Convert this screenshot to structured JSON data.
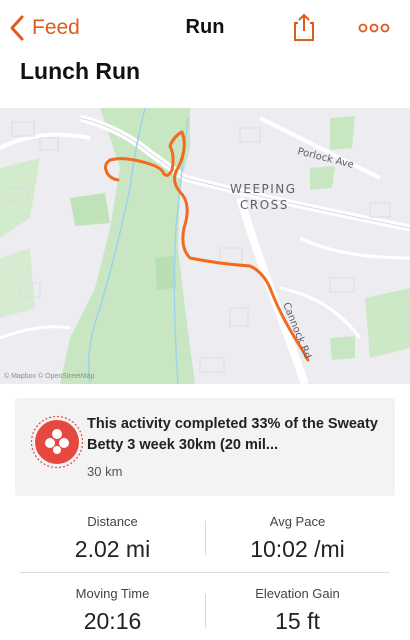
{
  "nav": {
    "back_label": "Feed",
    "title": "Run"
  },
  "activity": {
    "title": "Lunch Run"
  },
  "map": {
    "labels": [
      "Porlock Ave",
      "WEEPING",
      "CROSS",
      "Cannock Rd"
    ],
    "attribution": "© Mapbox © OpenStreetMap",
    "route_color": "#f26a1d"
  },
  "challenge": {
    "text": "This activity completed 33% of the Sweaty Betty 3 week 30km (20 mil...",
    "distance": "30 km",
    "progress_percent": 33,
    "badge_color": "#e5483f"
  },
  "stats": [
    {
      "label": "Distance",
      "value": "2.02 mi"
    },
    {
      "label": "Avg Pace",
      "value": "10:02 /mi"
    },
    {
      "label": "Moving Time",
      "value": "20:16"
    },
    {
      "label": "Elevation Gain",
      "value": "15 ft"
    }
  ],
  "colors": {
    "accent": "#e05a1a"
  }
}
